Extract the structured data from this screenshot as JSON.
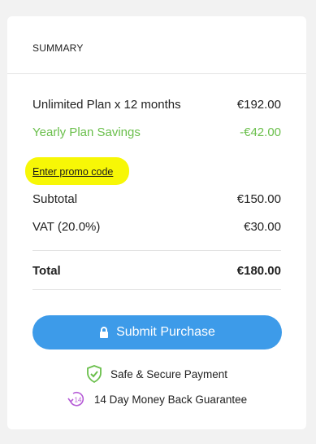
{
  "summary": {
    "title": "SUMMARY",
    "plan_label": "Unlimited Plan x 12 months",
    "plan_price": "€192.00",
    "savings_label": "Yearly Plan Savings",
    "savings_amount": "-€42.00",
    "promo_link": "Enter promo code",
    "subtotal_label": "Subtotal",
    "subtotal_amount": "€150.00",
    "vat_label": "VAT (20.0%)",
    "vat_amount": "€30.00",
    "total_label": "Total",
    "total_amount": "€180.00"
  },
  "actions": {
    "submit_label": "Submit Purchase"
  },
  "assurances": {
    "secure_label": "Safe & Secure Payment",
    "guarantee_label": "14 Day Money Back Guarantee",
    "guarantee_badge": "14"
  },
  "colors": {
    "accent": "#3d9be9",
    "savings": "#6abf4b",
    "highlight": "#f7f706",
    "shield": "#6abf4b",
    "guarantee": "#b55ad6"
  },
  "icons": {
    "lock": "lock-icon",
    "shield": "shield-check-icon",
    "guarantee": "money-back-14-icon"
  }
}
